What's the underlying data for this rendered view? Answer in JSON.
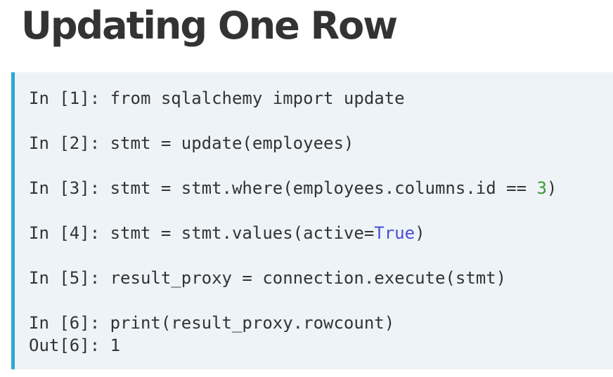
{
  "slide": {
    "title": "Updating One Row"
  },
  "code": {
    "lines": [
      {
        "prompt": "In [1]: ",
        "text": "from sqlalchemy import update"
      },
      {
        "prompt": "In [2]: ",
        "text": "stmt = update(employees)"
      },
      {
        "prompt": "In [3]: ",
        "before": "stmt = stmt.where(employees.columns.id == ",
        "highlight": "3",
        "after": ")"
      },
      {
        "prompt": "In [4]: ",
        "before": "stmt = stmt.values(active=",
        "highlight": "True",
        "after": ")"
      },
      {
        "prompt": "In [5]: ",
        "text": "result_proxy = connection.execute(stmt)"
      },
      {
        "prompt": "In [6]: ",
        "text": "print(result_proxy.rowcount)"
      },
      {
        "prompt": "Out[6]: ",
        "text": "1"
      }
    ]
  },
  "colors": {
    "title": "#333333",
    "panel_background": "#eef3f7",
    "panel_accent_bar": "#2ea7d8",
    "number_literal": "#3a9a2b",
    "boolean_literal": "#4a4fd8"
  }
}
